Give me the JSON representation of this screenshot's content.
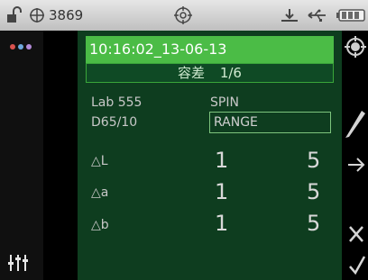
{
  "status": {
    "number": "3869"
  },
  "header": {
    "timestamp": "10:16:02_13-06-13"
  },
  "title": {
    "label": "容差",
    "page": "1/6"
  },
  "info": {
    "left_top": "Lab 555",
    "right_top": "SPIN",
    "left_bottom": "D65/10",
    "mode_value": "RANGE"
  },
  "tolerances": [
    {
      "label": "△L",
      "min": "1",
      "max": "5"
    },
    {
      "label": "△a",
      "min": "1",
      "max": "5"
    },
    {
      "label": "△b",
      "min": "1",
      "max": "5"
    }
  ],
  "colors": {
    "header_green": "#4bbc46",
    "panel_green": "#0e3d1f",
    "dot_colors": [
      "#d9534f",
      "#6fa8dc",
      "#b38bd8"
    ]
  },
  "icons": {
    "lock": "unlock-icon",
    "target": "crosshair-icon",
    "target2": "target-icon",
    "usb": "usb-icon",
    "battery": "battery-icon",
    "settings": "target-settings-icon",
    "edit": "pencil-icon",
    "next": "arrow-right-icon",
    "cancel": "close-icon",
    "confirm": "check-icon",
    "sliders": "sliders-icon",
    "dots": "color-dots-icon"
  }
}
